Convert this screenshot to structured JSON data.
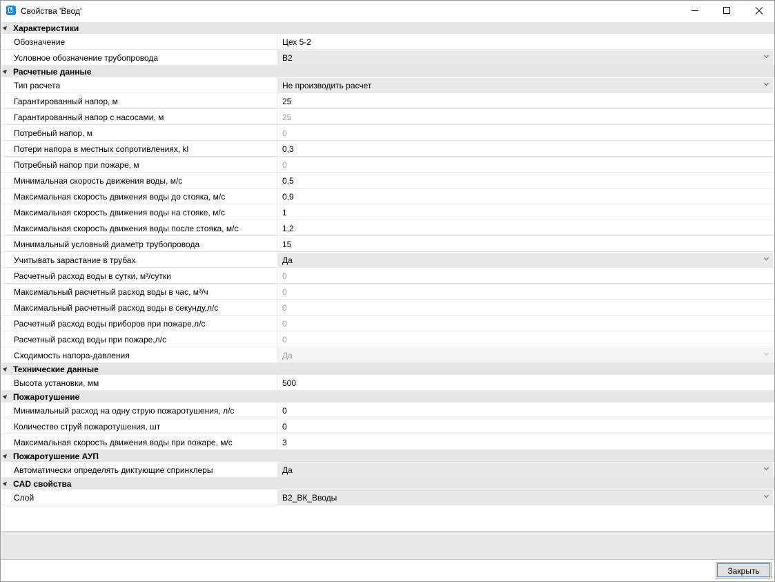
{
  "window": {
    "title": "Свойства 'Ввод'",
    "app_icon": "app-logo-icon",
    "controls": {
      "minimize_icon": "minimize-icon",
      "maximize_icon": "maximize-icon",
      "close_icon": "close-icon"
    }
  },
  "categories": [
    {
      "label": "Характеристики",
      "rows": [
        {
          "name": "Обозначение",
          "value": "Цех 5-2",
          "type": "text"
        },
        {
          "name": "Условное обозначение трубопровода",
          "value": "В2",
          "type": "combo"
        }
      ]
    },
    {
      "label": "Расчетные данные",
      "rows": [
        {
          "name": "Тип расчета",
          "value": "Не производить расчет",
          "type": "combo"
        },
        {
          "name": "Гарантированный напор, м",
          "value": "25",
          "type": "text"
        },
        {
          "name": "Гарантированный напор с насосами, м",
          "value": "25",
          "type": "disabled"
        },
        {
          "name": "Потребный напор, м",
          "value": "0",
          "type": "disabled"
        },
        {
          "name": "Потери напора в местных сопротивлениях, kl",
          "value": "0,3",
          "type": "text"
        },
        {
          "name": "Потребный напор при пожаре, м",
          "value": "0",
          "type": "disabled"
        },
        {
          "name": "Минимальная скорость движения воды, м/с",
          "value": "0,5",
          "type": "text"
        },
        {
          "name": "Максимальная скорость движения воды до стояка, м/с",
          "value": "0,9",
          "type": "text"
        },
        {
          "name": "Максимальная скорость движения воды на стояке, м/с",
          "value": "1",
          "type": "text"
        },
        {
          "name": "Максимальная скорость движения воды после стояка, м/с",
          "value": "1,2",
          "type": "text"
        },
        {
          "name": "Минимальный условный диаметр трубопровода",
          "value": "15",
          "type": "text"
        },
        {
          "name": "Учитывать зарастание в трубах",
          "value": "Да",
          "type": "combo"
        },
        {
          "name": "Расчетный расход воды в сутки, м³/сутки",
          "value": "0",
          "type": "disabled"
        },
        {
          "name": "Максимальный расчетный расход воды в час, м³/ч",
          "value": "0",
          "type": "disabled"
        },
        {
          "name": "Максимальный расчетный расход воды в секунду,л/с",
          "value": "0",
          "type": "disabled"
        },
        {
          "name": "Расчетный расход воды приборов при пожаре,л/с",
          "value": "0",
          "type": "disabled"
        },
        {
          "name": "Расчетный расход воды при пожаре,л/с",
          "value": "0",
          "type": "disabled"
        },
        {
          "name": "Сходимость напора-давления",
          "value": "Да",
          "type": "combo-disabled"
        }
      ]
    },
    {
      "label": "Технические данные",
      "rows": [
        {
          "name": "Высота установки, мм",
          "value": "500",
          "type": "text"
        }
      ]
    },
    {
      "label": "Пожаротушение",
      "rows": [
        {
          "name": "Минимальный расход на одну струю пожаротушения, л/с",
          "value": "0",
          "type": "text"
        },
        {
          "name": "Количество струй пожаротушения, шт",
          "value": "0",
          "type": "text"
        },
        {
          "name": "Максимальная скорость движения воды при пожаре, м/с",
          "value": "3",
          "type": "text"
        }
      ]
    },
    {
      "label": "Пожаротушение АУП",
      "rows": [
        {
          "name": "Автоматически определять диктующие спринклеры",
          "value": "Да",
          "type": "combo"
        }
      ]
    },
    {
      "label": "CAD свойства",
      "rows": [
        {
          "name": "Слой",
          "value": "В2_ВК_Вводы",
          "type": "combo"
        }
      ]
    }
  ],
  "footer": {
    "close_label": "Закрыть"
  }
}
